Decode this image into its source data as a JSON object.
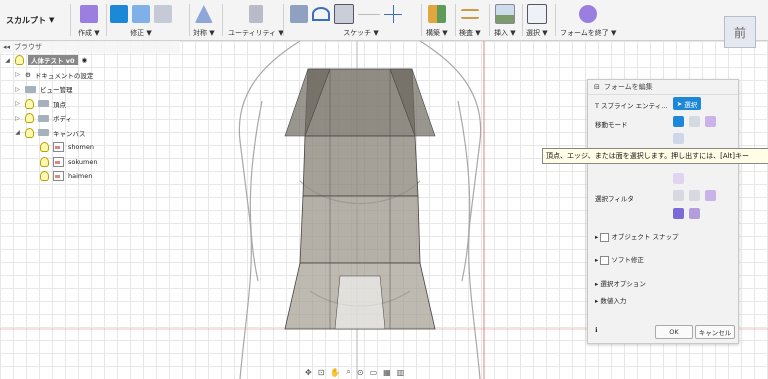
{
  "toolbar": {
    "workspace": "スカルプト",
    "groups": [
      {
        "label": "作成"
      },
      {
        "label": "修正"
      },
      {
        "label": "対称"
      },
      {
        "label": "ユーティリティ"
      },
      {
        "label": "スケッチ"
      },
      {
        "label": "構築"
      },
      {
        "label": "検査"
      },
      {
        "label": "挿入"
      },
      {
        "label": "選択"
      },
      {
        "label": "フォームを終了"
      }
    ]
  },
  "browser": {
    "title": "ブラウザ",
    "items": [
      {
        "label": "人体テスト v0"
      },
      {
        "label": "ドキュメントの設定"
      },
      {
        "label": "ビュー管理"
      },
      {
        "label": "頂点"
      },
      {
        "label": "ボディ"
      },
      {
        "label": "キャンバス"
      },
      {
        "label": "shomen"
      },
      {
        "label": "sokumen"
      },
      {
        "label": "haimen"
      }
    ]
  },
  "panel": {
    "title": "フォームを編集",
    "tspline_label": "T スプライン エンティ...",
    "select_button": "選択",
    "move_mode_label": "移動モード",
    "select_filter_label": "選択フィルタ",
    "object_snap": "オブジェクト スナップ",
    "soft_modify": "ソフト修正",
    "selection_options": "選択オプション",
    "numeric_input": "数値入力",
    "ok": "OK",
    "cancel": "キャンセル"
  },
  "tooltip": "頂点、エッジ、または面を選択します。押し出すには、[Alt]キー",
  "viewcube": "前",
  "colors": {
    "accent": "#1e88d8",
    "form_fill": "#8f8a80",
    "red_axis": "#e06060"
  }
}
